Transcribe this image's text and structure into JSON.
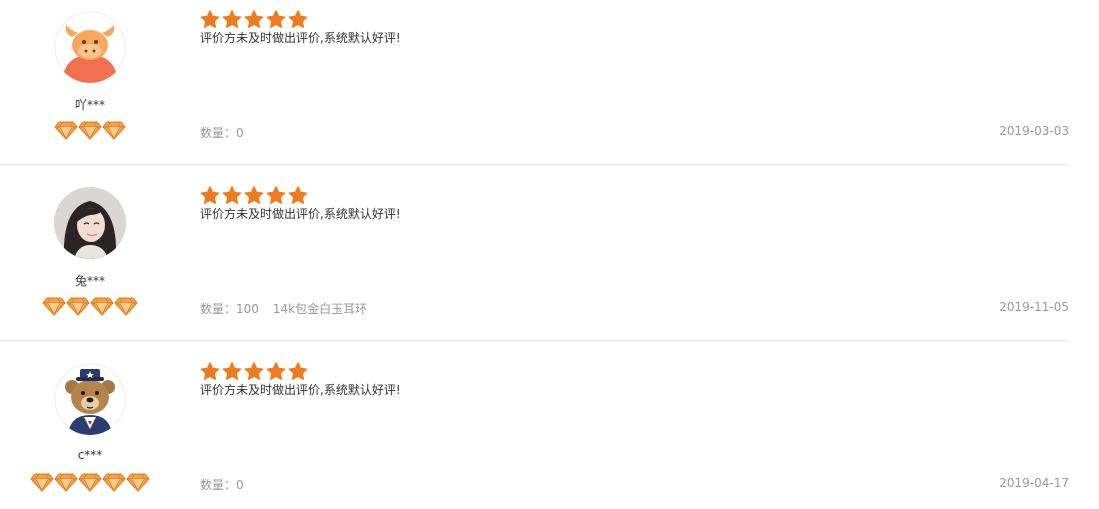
{
  "colors": {
    "star": "#f07b1d",
    "diamond": "#f5a34a",
    "divider": "#e5e5e5",
    "muted_text": "#999999"
  },
  "reviews": [
    {
      "username": "吖***",
      "avatar_icon": "cow-avatar-icon",
      "rating": 5,
      "diamond_count": 3,
      "comment": "评价方未及时做出评价,系统默认好评!",
      "quantity_text": "数量：0",
      "product": "",
      "date": "2019-03-03"
    },
    {
      "username": "兔***",
      "avatar_icon": "woman-photo-avatar-icon",
      "rating": 5,
      "diamond_count": 4,
      "comment": "评价方未及时做出评价,系统默认好评!",
      "quantity_text": "数量：100",
      "product": "14k包金白玉耳环",
      "date": "2019-11-05"
    },
    {
      "username": "c***",
      "avatar_icon": "teddy-bear-avatar-icon",
      "rating": 5,
      "diamond_count": 5,
      "comment": "评价方未及时做出评价,系统默认好评!",
      "quantity_text": "数量：0",
      "product": "",
      "date": "2019-04-17"
    }
  ]
}
